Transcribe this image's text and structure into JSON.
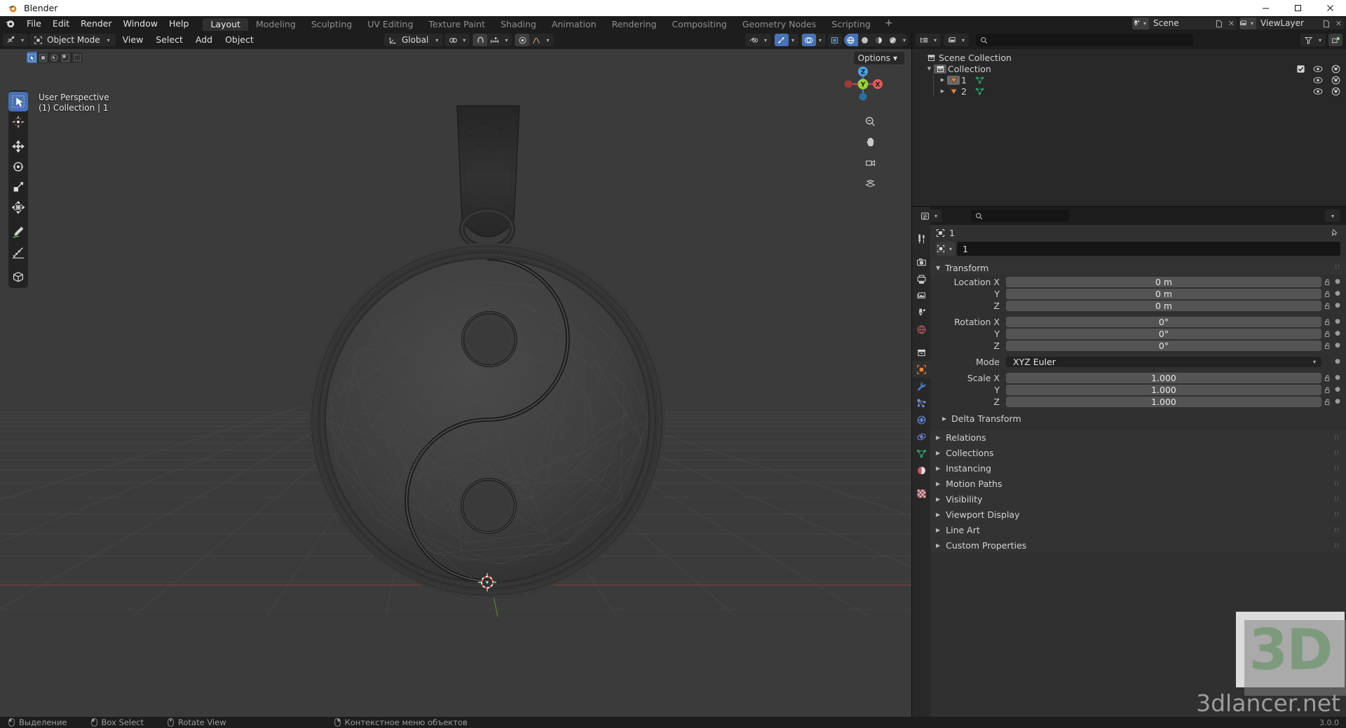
{
  "window": {
    "title": "Blender",
    "buttons": [
      "minimize",
      "maximize",
      "close"
    ]
  },
  "topbar": {
    "menus": [
      "File",
      "Edit",
      "Render",
      "Window",
      "Help"
    ],
    "workspaces": [
      {
        "label": "Layout",
        "active": true
      },
      {
        "label": "Modeling",
        "active": false
      },
      {
        "label": "Sculpting",
        "active": false
      },
      {
        "label": "UV Editing",
        "active": false
      },
      {
        "label": "Texture Paint",
        "active": false
      },
      {
        "label": "Shading",
        "active": false
      },
      {
        "label": "Animation",
        "active": false
      },
      {
        "label": "Rendering",
        "active": false
      },
      {
        "label": "Compositing",
        "active": false
      },
      {
        "label": "Geometry Nodes",
        "active": false
      },
      {
        "label": "Scripting",
        "active": false
      }
    ],
    "add_workspace_label": "+",
    "scene": {
      "name": "Scene",
      "icon": "scene-icon"
    },
    "view_layer": {
      "name": "ViewLayer",
      "icon": "viewlayer-icon"
    }
  },
  "viewport": {
    "mode": "Object Mode",
    "menus": [
      "View",
      "Select",
      "Add",
      "Object"
    ],
    "transform_orientation": "Global",
    "options_label": "Options",
    "overlay_line1": "User Perspective",
    "overlay_line2": "(1) Collection | 1",
    "gizmo_axes": [
      "Z",
      "Y",
      "X"
    ],
    "select_modes": [
      "tweak",
      "box-select",
      "circle-select",
      "lasso-select",
      "select-box-alt"
    ],
    "tools": [
      {
        "name": "tweak-tool",
        "active": true
      },
      {
        "name": "cursor-tool",
        "active": false
      },
      {
        "name": "move-tool",
        "active": false
      },
      {
        "name": "rotate-tool",
        "active": false
      },
      {
        "name": "scale-tool",
        "active": false
      },
      {
        "name": "transform-tool",
        "active": false
      },
      {
        "name": "annotate-tool",
        "active": false
      },
      {
        "name": "measure-tool",
        "active": false
      },
      {
        "name": "add-cube-tool",
        "active": false
      }
    ],
    "nav_buttons": [
      "zoom-icon",
      "hand-icon",
      "camera-icon",
      "ortho-persp-icon"
    ]
  },
  "outliner": {
    "search_placeholder": "",
    "rows": [
      {
        "label": "Scene Collection",
        "icon": "collection-icon",
        "depth": 0,
        "expandable": false,
        "checkbox": false,
        "visibility": false
      },
      {
        "label": "Collection",
        "icon": "collection-icon",
        "depth": 1,
        "expandable": true,
        "expanded": true,
        "checkbox": true,
        "visibility": true
      },
      {
        "label": "1",
        "icon": "mesh-object-icon",
        "depth": 2,
        "expandable": true,
        "expanded": false,
        "checkbox": false,
        "visibility": true,
        "selected": true,
        "data_icon": "mesh-data-icon"
      },
      {
        "label": "2",
        "icon": "mesh-object-icon",
        "depth": 2,
        "expandable": true,
        "expanded": false,
        "checkbox": false,
        "visibility": true,
        "selected": false,
        "data_icon": "mesh-data-icon"
      }
    ]
  },
  "properties": {
    "tabs": [
      {
        "name": "tool-tab",
        "active": false
      },
      {
        "name": "render-tab",
        "active": false
      },
      {
        "name": "output-tab",
        "active": false
      },
      {
        "name": "view-layer-tab",
        "active": false
      },
      {
        "name": "scene-tab",
        "active": false
      },
      {
        "name": "world-tab",
        "active": false
      },
      {
        "name": "collection-tab",
        "active": false
      },
      {
        "name": "object-tab",
        "active": true
      },
      {
        "name": "modifier-tab",
        "active": false
      },
      {
        "name": "particles-tab",
        "active": false
      },
      {
        "name": "physics-tab",
        "active": false
      },
      {
        "name": "constraints-tab",
        "active": false
      },
      {
        "name": "object-data-tab",
        "active": false
      },
      {
        "name": "material-tab",
        "active": false
      },
      {
        "name": "texture-tab",
        "active": false
      }
    ],
    "breadcrumb": "1",
    "id_name": "1",
    "search_placeholder": "",
    "transform": {
      "title": "Transform",
      "fields": [
        {
          "label": "Location X",
          "value": "0 m"
        },
        {
          "label": "Y",
          "value": "0 m"
        },
        {
          "label": "Z",
          "value": "0 m"
        },
        {
          "label": "Rotation X",
          "value": "0°"
        },
        {
          "label": "Y",
          "value": "0°"
        },
        {
          "label": "Z",
          "value": "0°"
        }
      ],
      "mode_label": "Mode",
      "mode_value": "XYZ Euler",
      "scale_fields": [
        {
          "label": "Scale X",
          "value": "1.000"
        },
        {
          "label": "Y",
          "value": "1.000"
        },
        {
          "label": "Z",
          "value": "1.000"
        }
      ],
      "delta_transform_label": "Delta Transform"
    },
    "panels": [
      {
        "label": "Relations"
      },
      {
        "label": "Collections"
      },
      {
        "label": "Instancing"
      },
      {
        "label": "Motion Paths"
      },
      {
        "label": "Visibility"
      },
      {
        "label": "Viewport Display"
      },
      {
        "label": "Line Art"
      },
      {
        "label": "Custom Properties"
      }
    ]
  },
  "watermark": {
    "badge": "3D",
    "text": "3dlancer.net"
  },
  "statusbar": {
    "items": [
      {
        "icon": "mouse-left-icon",
        "label": "Выделение"
      },
      {
        "icon": "mouse-left-drag-icon",
        "label": "Box Select"
      },
      {
        "icon": "mouse-middle-icon",
        "label": "Rotate View"
      },
      {
        "icon": "mouse-right-icon",
        "label": "Контекстное меню объектов"
      }
    ],
    "version": "3.0.0"
  },
  "colors": {
    "accent_blue": "#4772b3",
    "viewport_bg": "#3b3b3b",
    "panel_bg": "#303030",
    "header_bg": "#1d1d1d",
    "axis_green": "#5c7a29",
    "axis_red": "#7a3a3a",
    "gizmo_x": "#e05a5a",
    "gizmo_y": "#97d13c",
    "gizmo_z": "#4ba2e0"
  }
}
